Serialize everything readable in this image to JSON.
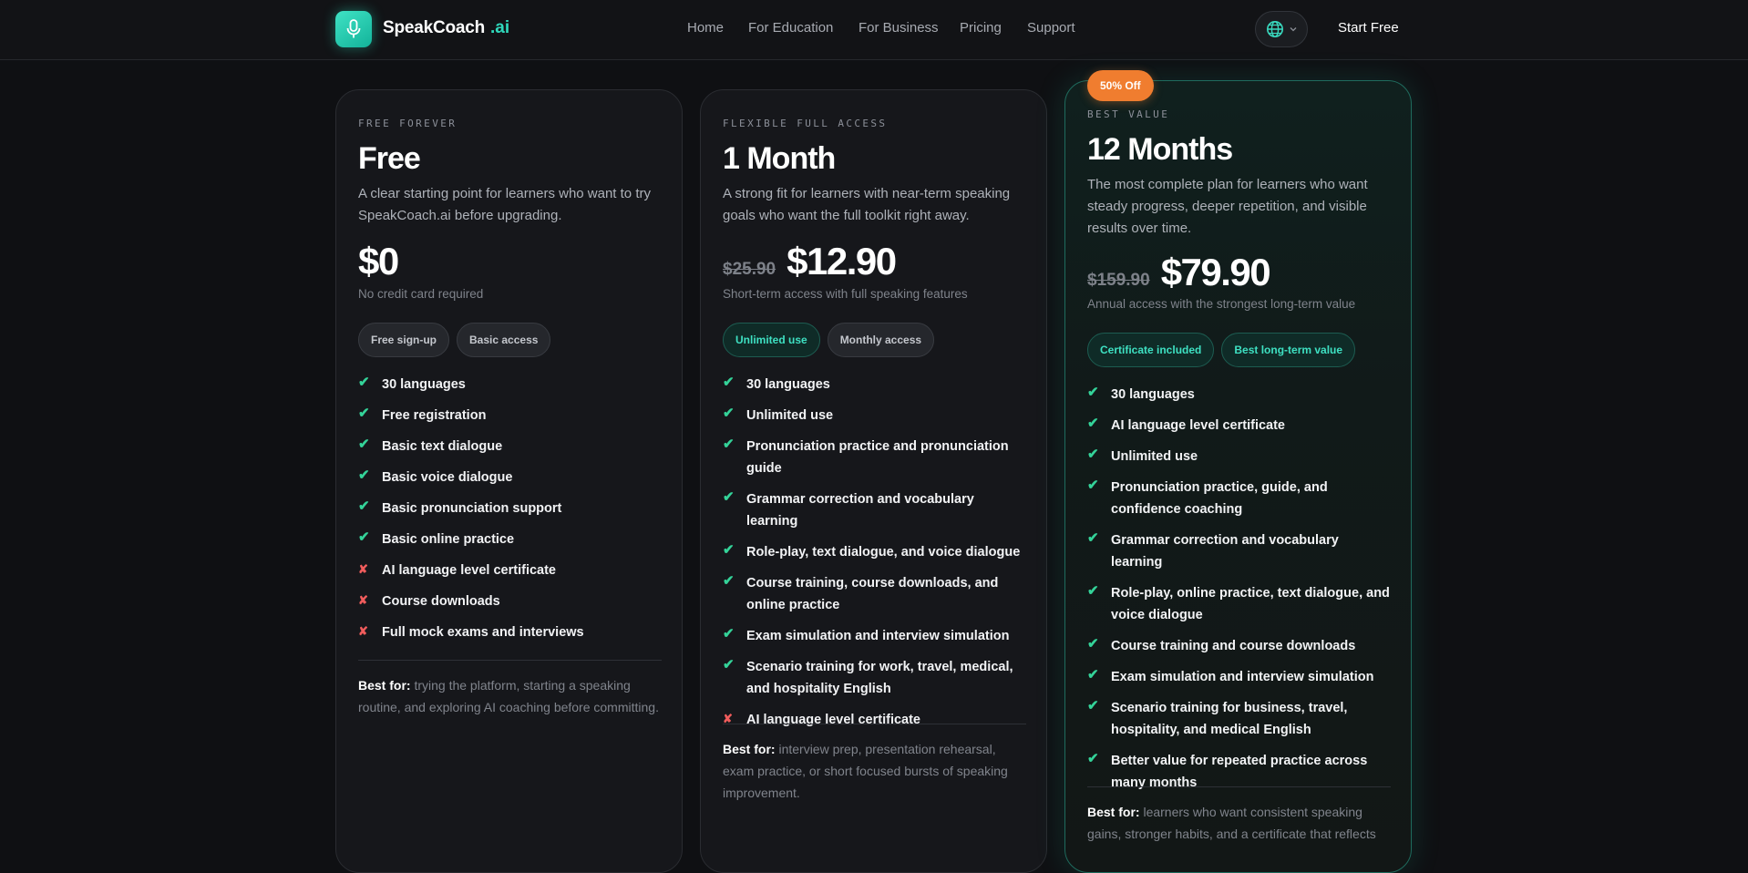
{
  "nav": {
    "brand": "SpeakCoach",
    "brand_suffix": ".ai",
    "links": [
      "Home",
      "For Education",
      "For Business",
      "Pricing",
      "Support"
    ],
    "start_free": "Start Free"
  },
  "plans": [
    {
      "kicker": "FREE FOREVER",
      "name": "Free",
      "description": "A clear starting point for learners who want to try SpeakCoach.ai before upgrading.",
      "old_price": "",
      "price": "$0",
      "price_note": "No credit card required",
      "tags": [
        {
          "label": "Free sign-up",
          "style": "gray"
        },
        {
          "label": "Basic access",
          "style": "gray"
        }
      ],
      "features": [
        {
          "text": "30 languages",
          "included": true
        },
        {
          "text": "Free registration",
          "included": true
        },
        {
          "text": "Basic text dialogue",
          "included": true
        },
        {
          "text": "Basic voice dialogue",
          "included": true
        },
        {
          "text": "Basic pronunciation support",
          "included": true
        },
        {
          "text": "Basic online practice",
          "included": true
        },
        {
          "text": "AI language level certificate",
          "included": false
        },
        {
          "text": "Course downloads",
          "included": false
        },
        {
          "text": "Full mock exams and interviews",
          "included": false
        }
      ],
      "best_for_label": "Best for:",
      "best_for": "trying the platform, starting a speaking routine, and exploring AI coaching before committing."
    },
    {
      "kicker": "FLEXIBLE FULL ACCESS",
      "name": "1 Month",
      "description": "A strong fit for learners with near-term speaking goals who want the full toolkit right away.",
      "old_price": "$25.90",
      "price": "$12.90",
      "price_note": "Short-term access with full speaking features",
      "tags": [
        {
          "label": "Unlimited use",
          "style": "teal"
        },
        {
          "label": "Monthly access",
          "style": "gray"
        }
      ],
      "features": [
        {
          "text": "30 languages",
          "included": true
        },
        {
          "text": "Unlimited use",
          "included": true
        },
        {
          "text": "Pronunciation practice and pronunciation guide",
          "included": true
        },
        {
          "text": "Grammar correction and vocabulary learning",
          "included": true
        },
        {
          "text": "Role-play, text dialogue, and voice dialogue",
          "included": true
        },
        {
          "text": "Course training, course downloads, and online practice",
          "included": true
        },
        {
          "text": "Exam simulation and interview simulation",
          "included": true
        },
        {
          "text": "Scenario training for work, travel, medical, and hospitality English",
          "included": true
        },
        {
          "text": "AI language level certificate",
          "included": false
        }
      ],
      "best_for_label": "Best for:",
      "best_for": "interview prep, presentation rehearsal, exam practice, or short focused bursts of speaking improvement."
    },
    {
      "badge": "50% Off",
      "kicker": "BEST VALUE",
      "name": "12 Months",
      "description": "The most complete plan for learners who want steady progress, deeper repetition, and visible results over time.",
      "old_price": "$159.90",
      "price": "$79.90",
      "price_note": "Annual access with the strongest long-term value",
      "tags": [
        {
          "label": "Certificate included",
          "style": "teal"
        },
        {
          "label": "Best long-term value",
          "style": "teal"
        }
      ],
      "features": [
        {
          "text": "30 languages",
          "included": true
        },
        {
          "text": "AI language level certificate",
          "included": true
        },
        {
          "text": "Unlimited use",
          "included": true
        },
        {
          "text": "Pronunciation practice, guide, and confidence coaching",
          "included": true
        },
        {
          "text": "Grammar correction and vocabulary learning",
          "included": true
        },
        {
          "text": "Role-play, online practice, text dialogue, and voice dialogue",
          "included": true
        },
        {
          "text": "Course training and course downloads",
          "included": true
        },
        {
          "text": "Exam simulation and interview simulation",
          "included": true
        },
        {
          "text": "Scenario training for business, travel, hospitality, and medical English",
          "included": true
        },
        {
          "text": "Better value for repeated practice across many months",
          "included": true
        }
      ],
      "best_for_label": "Best for:",
      "best_for": "learners who want consistent speaking gains, stronger habits, and a certificate that reflects"
    }
  ]
}
